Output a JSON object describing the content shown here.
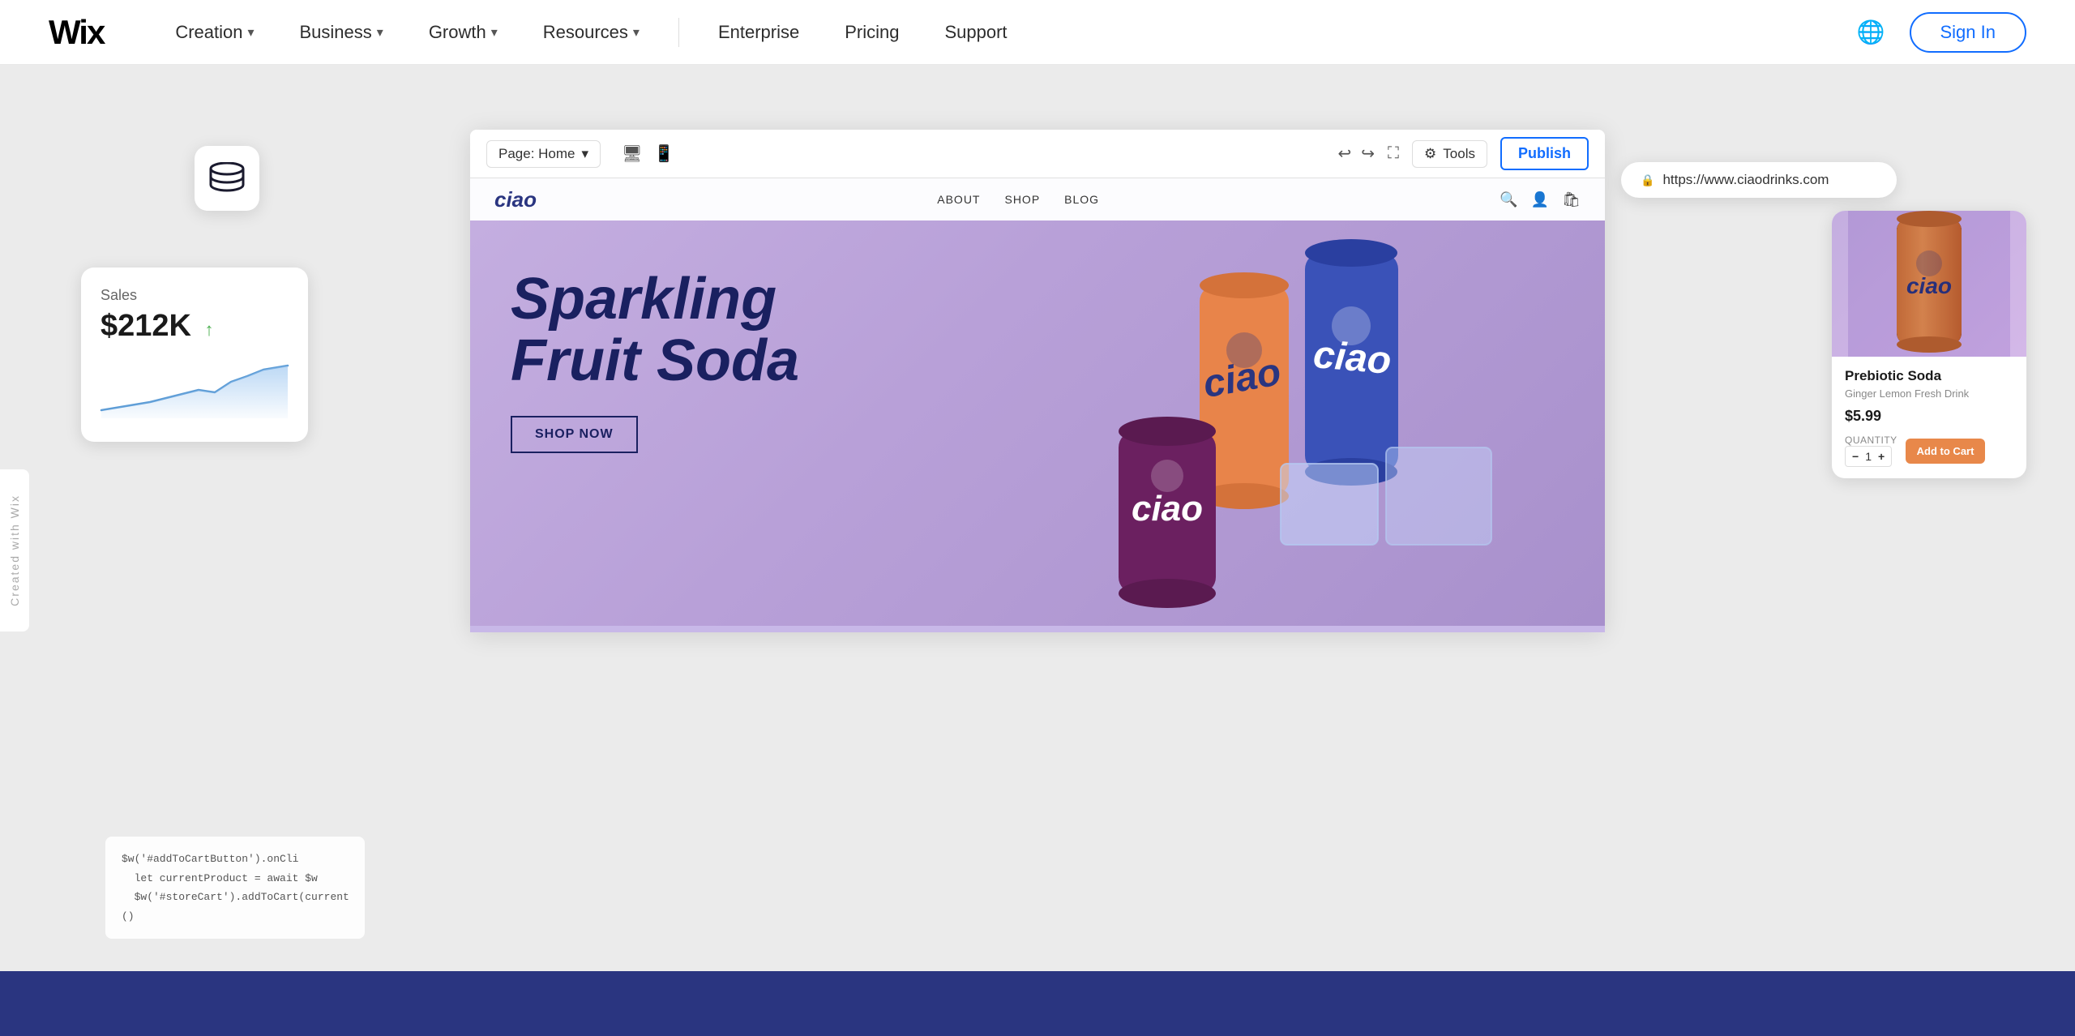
{
  "navbar": {
    "logo": "Wix",
    "items": [
      {
        "label": "Creation",
        "hasDropdown": true
      },
      {
        "label": "Business",
        "hasDropdown": true
      },
      {
        "label": "Growth",
        "hasDropdown": true
      },
      {
        "label": "Resources",
        "hasDropdown": true
      },
      {
        "label": "Enterprise",
        "hasDropdown": false
      },
      {
        "label": "Pricing",
        "hasDropdown": false
      },
      {
        "label": "Support",
        "hasDropdown": false
      }
    ],
    "sign_in": "Sign In"
  },
  "editor": {
    "page_selector": "Page: Home",
    "tools_label": "Tools",
    "publish_label": "Publish",
    "url_bar": "https://www.ciaodrinks.com"
  },
  "site": {
    "logo": "ciao",
    "nav_links": [
      "ABOUT",
      "SHOP",
      "BLOG"
    ],
    "hero_title": "Sparkling\nFruit Soda",
    "shop_now": "SHOP NOW"
  },
  "sales_card": {
    "label": "Sales",
    "value": "$212K",
    "trend": "↑"
  },
  "product_card": {
    "name": "Prebiotic Soda",
    "description": "Ginger Lemon Fresh Drink",
    "price": "$5.99",
    "quantity_label": "QUANTITY",
    "quantity": "1",
    "add_to_cart": "Add to Cart"
  },
  "code_snippet": {
    "lines": [
      "$w('#addToCartButton').onCli",
      "  let currentProduct = await $w",
      "  $w('#storeCart').addToCart(currentProduct._id)",
      "()"
    ]
  },
  "wix_brand": {
    "text": "Created with Wix"
  }
}
